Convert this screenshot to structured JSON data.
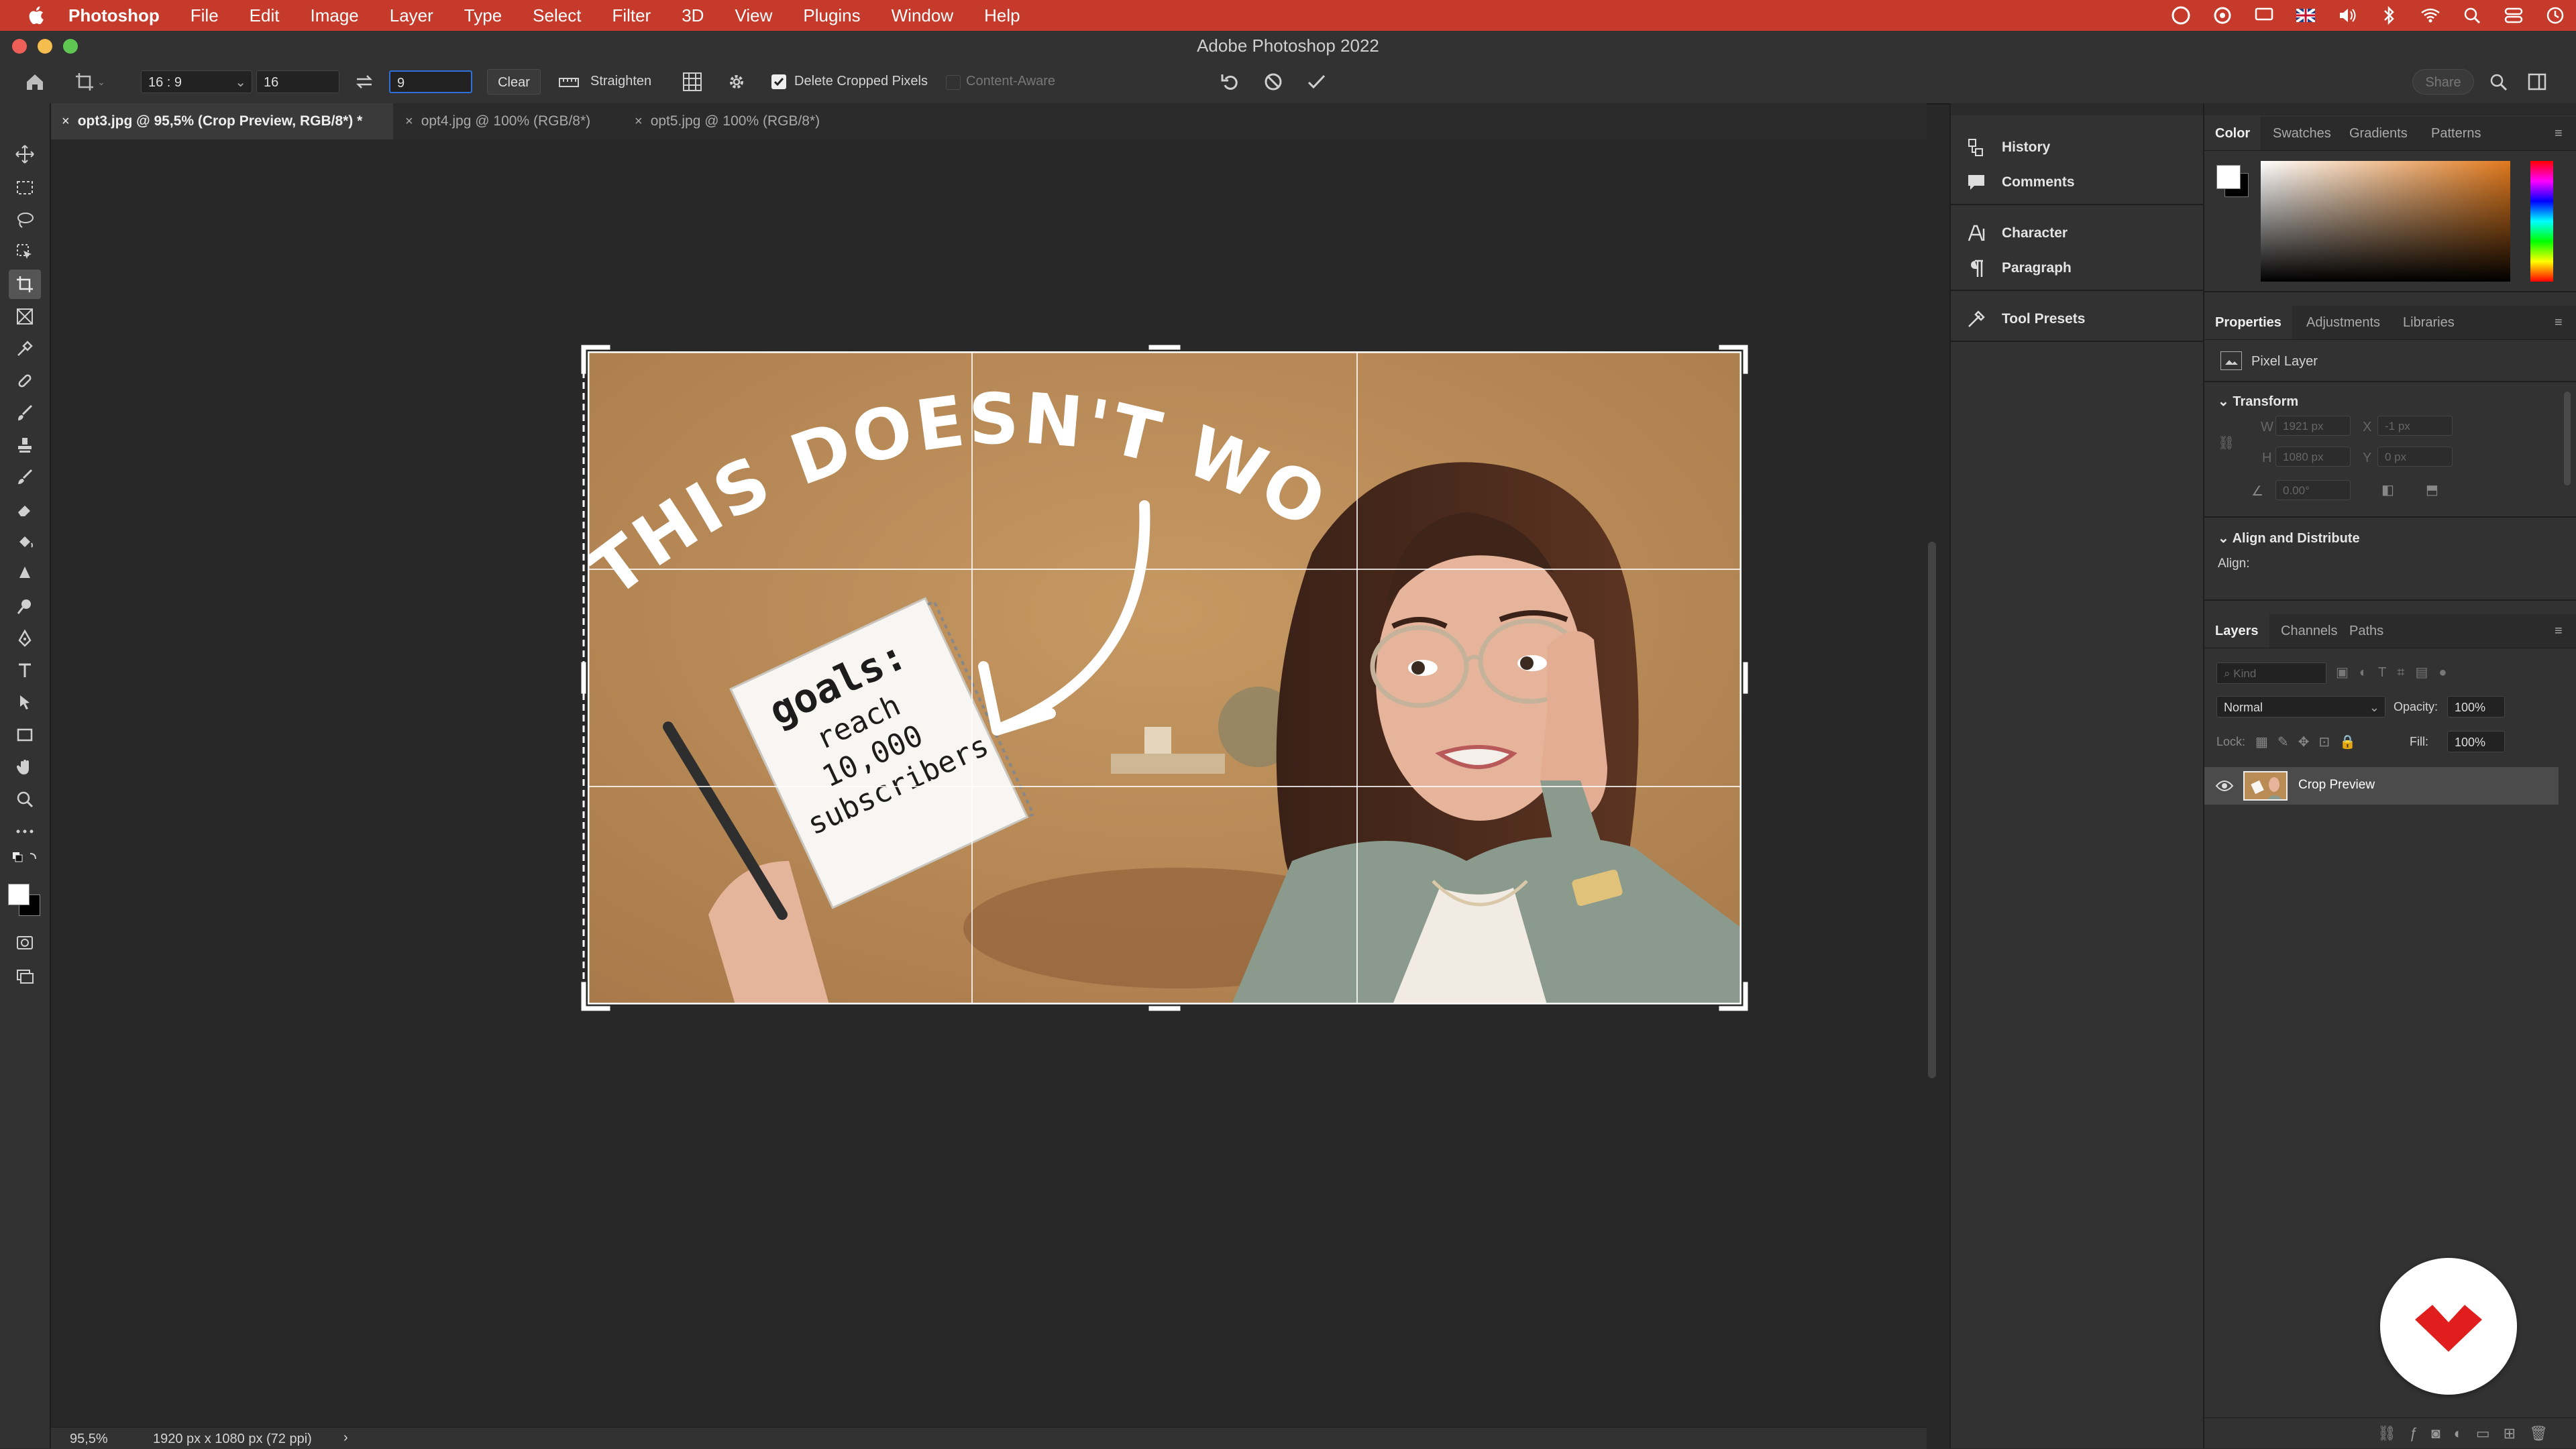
{
  "menubar": {
    "app": "Photoshop",
    "items": [
      "File",
      "Edit",
      "Image",
      "Layer",
      "Type",
      "Select",
      "Filter",
      "3D",
      "View",
      "Plugins",
      "Window",
      "Help"
    ]
  },
  "window": {
    "title": "Adobe Photoshop 2022"
  },
  "options": {
    "ratio_preset": "16 : 9",
    "width": "16",
    "height": "9",
    "clear": "Clear",
    "straighten": "Straighten",
    "delete_cropped": "Delete Cropped Pixels",
    "delete_cropped_checked": true,
    "content_aware": "Content-Aware",
    "share": "Share"
  },
  "tabs": [
    {
      "label": "opt3.jpg @ 95,5% (Crop Preview, RGB/8*) *",
      "active": true
    },
    {
      "label": "opt4.jpg @ 100% (RGB/8*)",
      "active": false
    },
    {
      "label": "opt5.jpg @ 100% (RGB/8*)",
      "active": false
    }
  ],
  "image": {
    "headline": "THIS DOESN'T WORK!",
    "note_line1": "goals:",
    "note_line2": "reach",
    "note_line3": "10,000",
    "note_line4": "subscribers"
  },
  "status": {
    "zoom": "95,5%",
    "doc_info": "1920 px x 1080 px (72 ppi)"
  },
  "dock": {
    "items": [
      "History",
      "Comments",
      "Character",
      "Paragraph",
      "Tool Presets"
    ]
  },
  "color_panel": {
    "tabs": [
      "Color",
      "Swatches",
      "Gradients",
      "Patterns"
    ]
  },
  "properties_panel": {
    "tabs": [
      "Properties",
      "Adjustments",
      "Libraries"
    ],
    "layer_type": "Pixel Layer",
    "transform": "Transform",
    "w": "1921 px",
    "x": "-1 px",
    "h": "1080 px",
    "y": "0 px",
    "angle": "0.00°",
    "align_distribute": "Align and Distribute",
    "align": "Align:"
  },
  "layers_panel": {
    "tabs": [
      "Layers",
      "Channels",
      "Paths"
    ],
    "kind_placeholder": "Kind",
    "blend_mode": "Normal",
    "opacity_label": "Opacity:",
    "opacity": "100%",
    "lock_label": "Lock:",
    "fill_label": "Fill:",
    "fill": "100%",
    "layers": [
      {
        "name": "Crop Preview",
        "visible": true
      }
    ]
  },
  "colors": {
    "menubar": "#c53a2b",
    "photo_background": "#b98c55",
    "logo_red": "#e01e1e"
  }
}
